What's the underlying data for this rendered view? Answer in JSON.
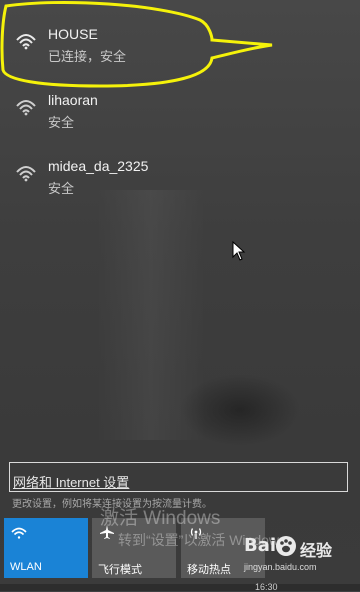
{
  "networks": [
    {
      "name": "HOUSE",
      "status": "已连接，安全",
      "connected": true
    },
    {
      "name": "lihaoran",
      "status": "安全",
      "connected": false
    },
    {
      "name": "midea_da_2325",
      "status": "安全",
      "connected": false
    }
  ],
  "settings": {
    "link_label": "网络和 Internet 设置",
    "description": "更改设置，例如将某连接设置为按流量计费。"
  },
  "tiles": [
    {
      "label": "WLAN",
      "icon": "wifi-icon",
      "active": true
    },
    {
      "label": "飞行模式",
      "icon": "airplane-icon",
      "active": false
    },
    {
      "label": "移动热点",
      "icon": "hotspot-icon",
      "active": false
    }
  ],
  "watermark": {
    "line1": "激活 Windows",
    "line2": "转到“设置”以激活 Windows。"
  },
  "baidu": {
    "logo_text": "Bai",
    "jingyan": "经验",
    "url": "jingyan.baidu.com"
  },
  "clock": "16:30",
  "colors": {
    "accent": "#1a83d6",
    "highlight": "#f5f20a",
    "background": "#3f4042"
  }
}
